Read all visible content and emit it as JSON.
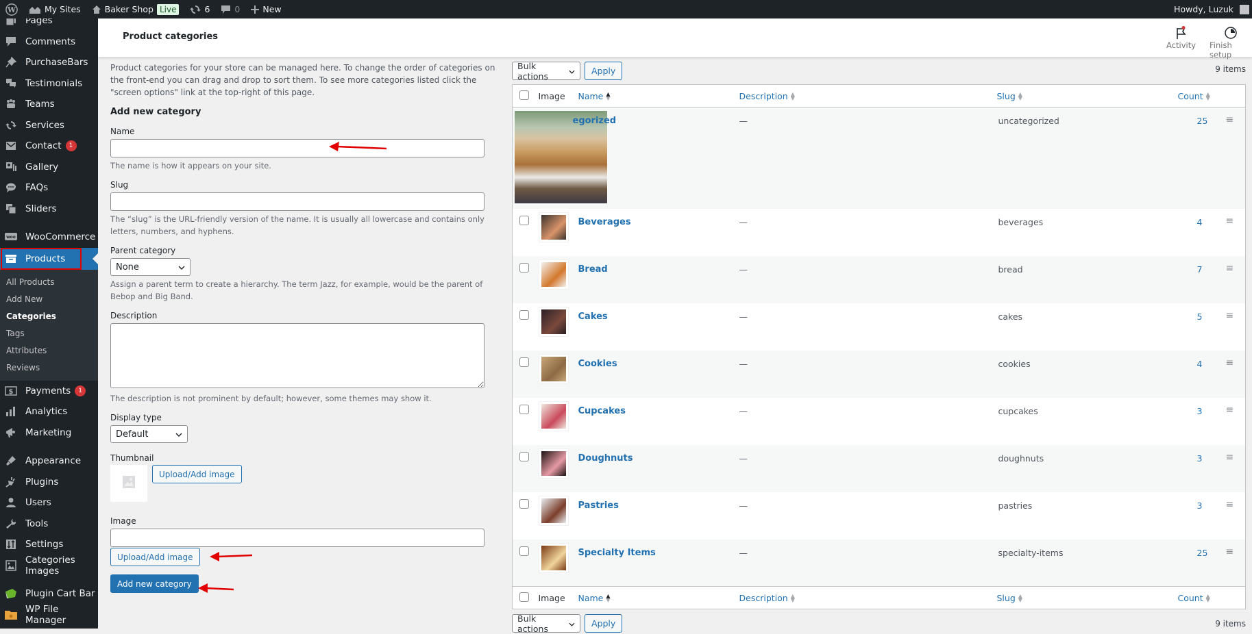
{
  "admin_bar": {
    "wp_logo": "wordpress-logo",
    "my_sites": "My Sites",
    "site_name": "Baker Shop",
    "live_badge": "Live",
    "updates_count": "6",
    "comments_count": "0",
    "new_label": "New",
    "howdy": "Howdy, Luzuk"
  },
  "sidebar": {
    "items": [
      {
        "label": "Pages",
        "icon": "pages-icon"
      },
      {
        "label": "Comments",
        "icon": "comments-icon"
      },
      {
        "label": "PurchaseBars",
        "icon": "pin-icon"
      },
      {
        "label": "Testimonials",
        "icon": "testimonials-icon"
      },
      {
        "label": "Teams",
        "icon": "teams-icon"
      },
      {
        "label": "Services",
        "icon": "services-icon"
      },
      {
        "label": "Contact",
        "icon": "mail-icon",
        "badge": "1"
      },
      {
        "label": "Gallery",
        "icon": "gallery-icon"
      },
      {
        "label": "FAQs",
        "icon": "faq-icon"
      },
      {
        "label": "Sliders",
        "icon": "sliders-icon"
      },
      {
        "label": "WooCommerce",
        "icon": "woocommerce-icon"
      },
      {
        "label": "Products",
        "icon": "products-icon",
        "active": true
      },
      {
        "label": "Payments",
        "icon": "payments-icon",
        "badge": "1"
      },
      {
        "label": "Analytics",
        "icon": "analytics-icon"
      },
      {
        "label": "Marketing",
        "icon": "marketing-icon"
      },
      {
        "label": "Appearance",
        "icon": "appearance-icon"
      },
      {
        "label": "Plugins",
        "icon": "plugins-icon"
      },
      {
        "label": "Users",
        "icon": "users-icon"
      },
      {
        "label": "Tools",
        "icon": "tools-icon"
      },
      {
        "label": "Settings",
        "icon": "settings-icon"
      },
      {
        "label": "Categories Images",
        "icon": "categories-images-icon"
      },
      {
        "label": "Plugin Cart Bar",
        "icon": "cart-bar-icon"
      },
      {
        "label": "WP File Manager",
        "icon": "file-manager-icon"
      }
    ],
    "submenu": [
      "All Products",
      "Add New",
      "Categories",
      "Tags",
      "Attributes",
      "Reviews"
    ],
    "submenu_current": "Categories"
  },
  "header": {
    "title": "Product categories",
    "activity_label": "Activity",
    "finish_setup_label": "Finish setup"
  },
  "form": {
    "intro": "Product categories for your store can be managed here. To change the order of categories on the front-end you can drag and drop to sort them. To see more categories listed click the \"screen options\" link at the top-right of this page.",
    "title": "Add new category",
    "name_label": "Name",
    "name_value": "",
    "name_help": "The name is how it appears on your site.",
    "slug_label": "Slug",
    "slug_value": "",
    "slug_help": "The “slug” is the URL-friendly version of the name. It is usually all lowercase and contains only letters, numbers, and hyphens.",
    "parent_label": "Parent category",
    "parent_value": "None",
    "parent_help": "Assign a parent term to create a hierarchy. The term Jazz, for example, would be the parent of Bebop and Big Band.",
    "description_label": "Description",
    "description_value": "",
    "description_help": "The description is not prominent by default; however, some themes may show it.",
    "display_type_label": "Display type",
    "display_type_value": "Default",
    "thumbnail_label": "Thumbnail",
    "thumbnail_upload": "Upload/Add image",
    "image_label": "Image",
    "image_value": "",
    "image_upload": "Upload/Add image",
    "submit": "Add new category"
  },
  "list": {
    "bulk_actions": "Bulk actions",
    "apply": "Apply",
    "items_count": "9 items",
    "columns": {
      "image": "Image",
      "name": "Name",
      "description": "Description",
      "slug": "Slug",
      "count": "Count"
    },
    "rows": [
      {
        "name": "egorized",
        "description": "—",
        "slug": "uncategorized",
        "count": "25",
        "thumb_colors": [
          "#c79a5f",
          "#e9e9e6"
        ],
        "large": true
      },
      {
        "name": "Beverages",
        "description": "—",
        "slug": "beverages",
        "count": "4",
        "thumb_colors": [
          "#3b332e",
          "#d9946a"
        ]
      },
      {
        "name": "Bread",
        "description": "—",
        "slug": "bread",
        "count": "7",
        "thumb_colors": [
          "#f4f1ee",
          "#d3782c"
        ]
      },
      {
        "name": "Cakes",
        "description": "—",
        "slug": "cakes",
        "count": "5",
        "thumb_colors": [
          "#2b1f24",
          "#7a4a3c"
        ]
      },
      {
        "name": "Cookies",
        "description": "—",
        "slug": "cookies",
        "count": "4",
        "thumb_colors": [
          "#c7a779",
          "#8d6a44"
        ]
      },
      {
        "name": "Cupcakes",
        "description": "—",
        "slug": "cupcakes",
        "count": "3",
        "thumb_colors": [
          "#efe6dc",
          "#c94a5c"
        ]
      },
      {
        "name": "Doughnuts",
        "description": "—",
        "slug": "doughnuts",
        "count": "3",
        "thumb_colors": [
          "#1e1414",
          "#e79aa4"
        ]
      },
      {
        "name": "Pastries",
        "description": "—",
        "slug": "pastries",
        "count": "3",
        "thumb_colors": [
          "#e9ecef",
          "#7b3e2a"
        ]
      },
      {
        "name": "Specialty Items",
        "description": "—",
        "slug": "specialty-items",
        "count": "25",
        "thumb_colors": [
          "#7a3a15",
          "#f1d49b"
        ]
      }
    ]
  },
  "colors": {
    "accent": "#2271b1",
    "admin_bg": "#1d2327",
    "badge": "#d63638",
    "annotation_red": "#e00000"
  }
}
